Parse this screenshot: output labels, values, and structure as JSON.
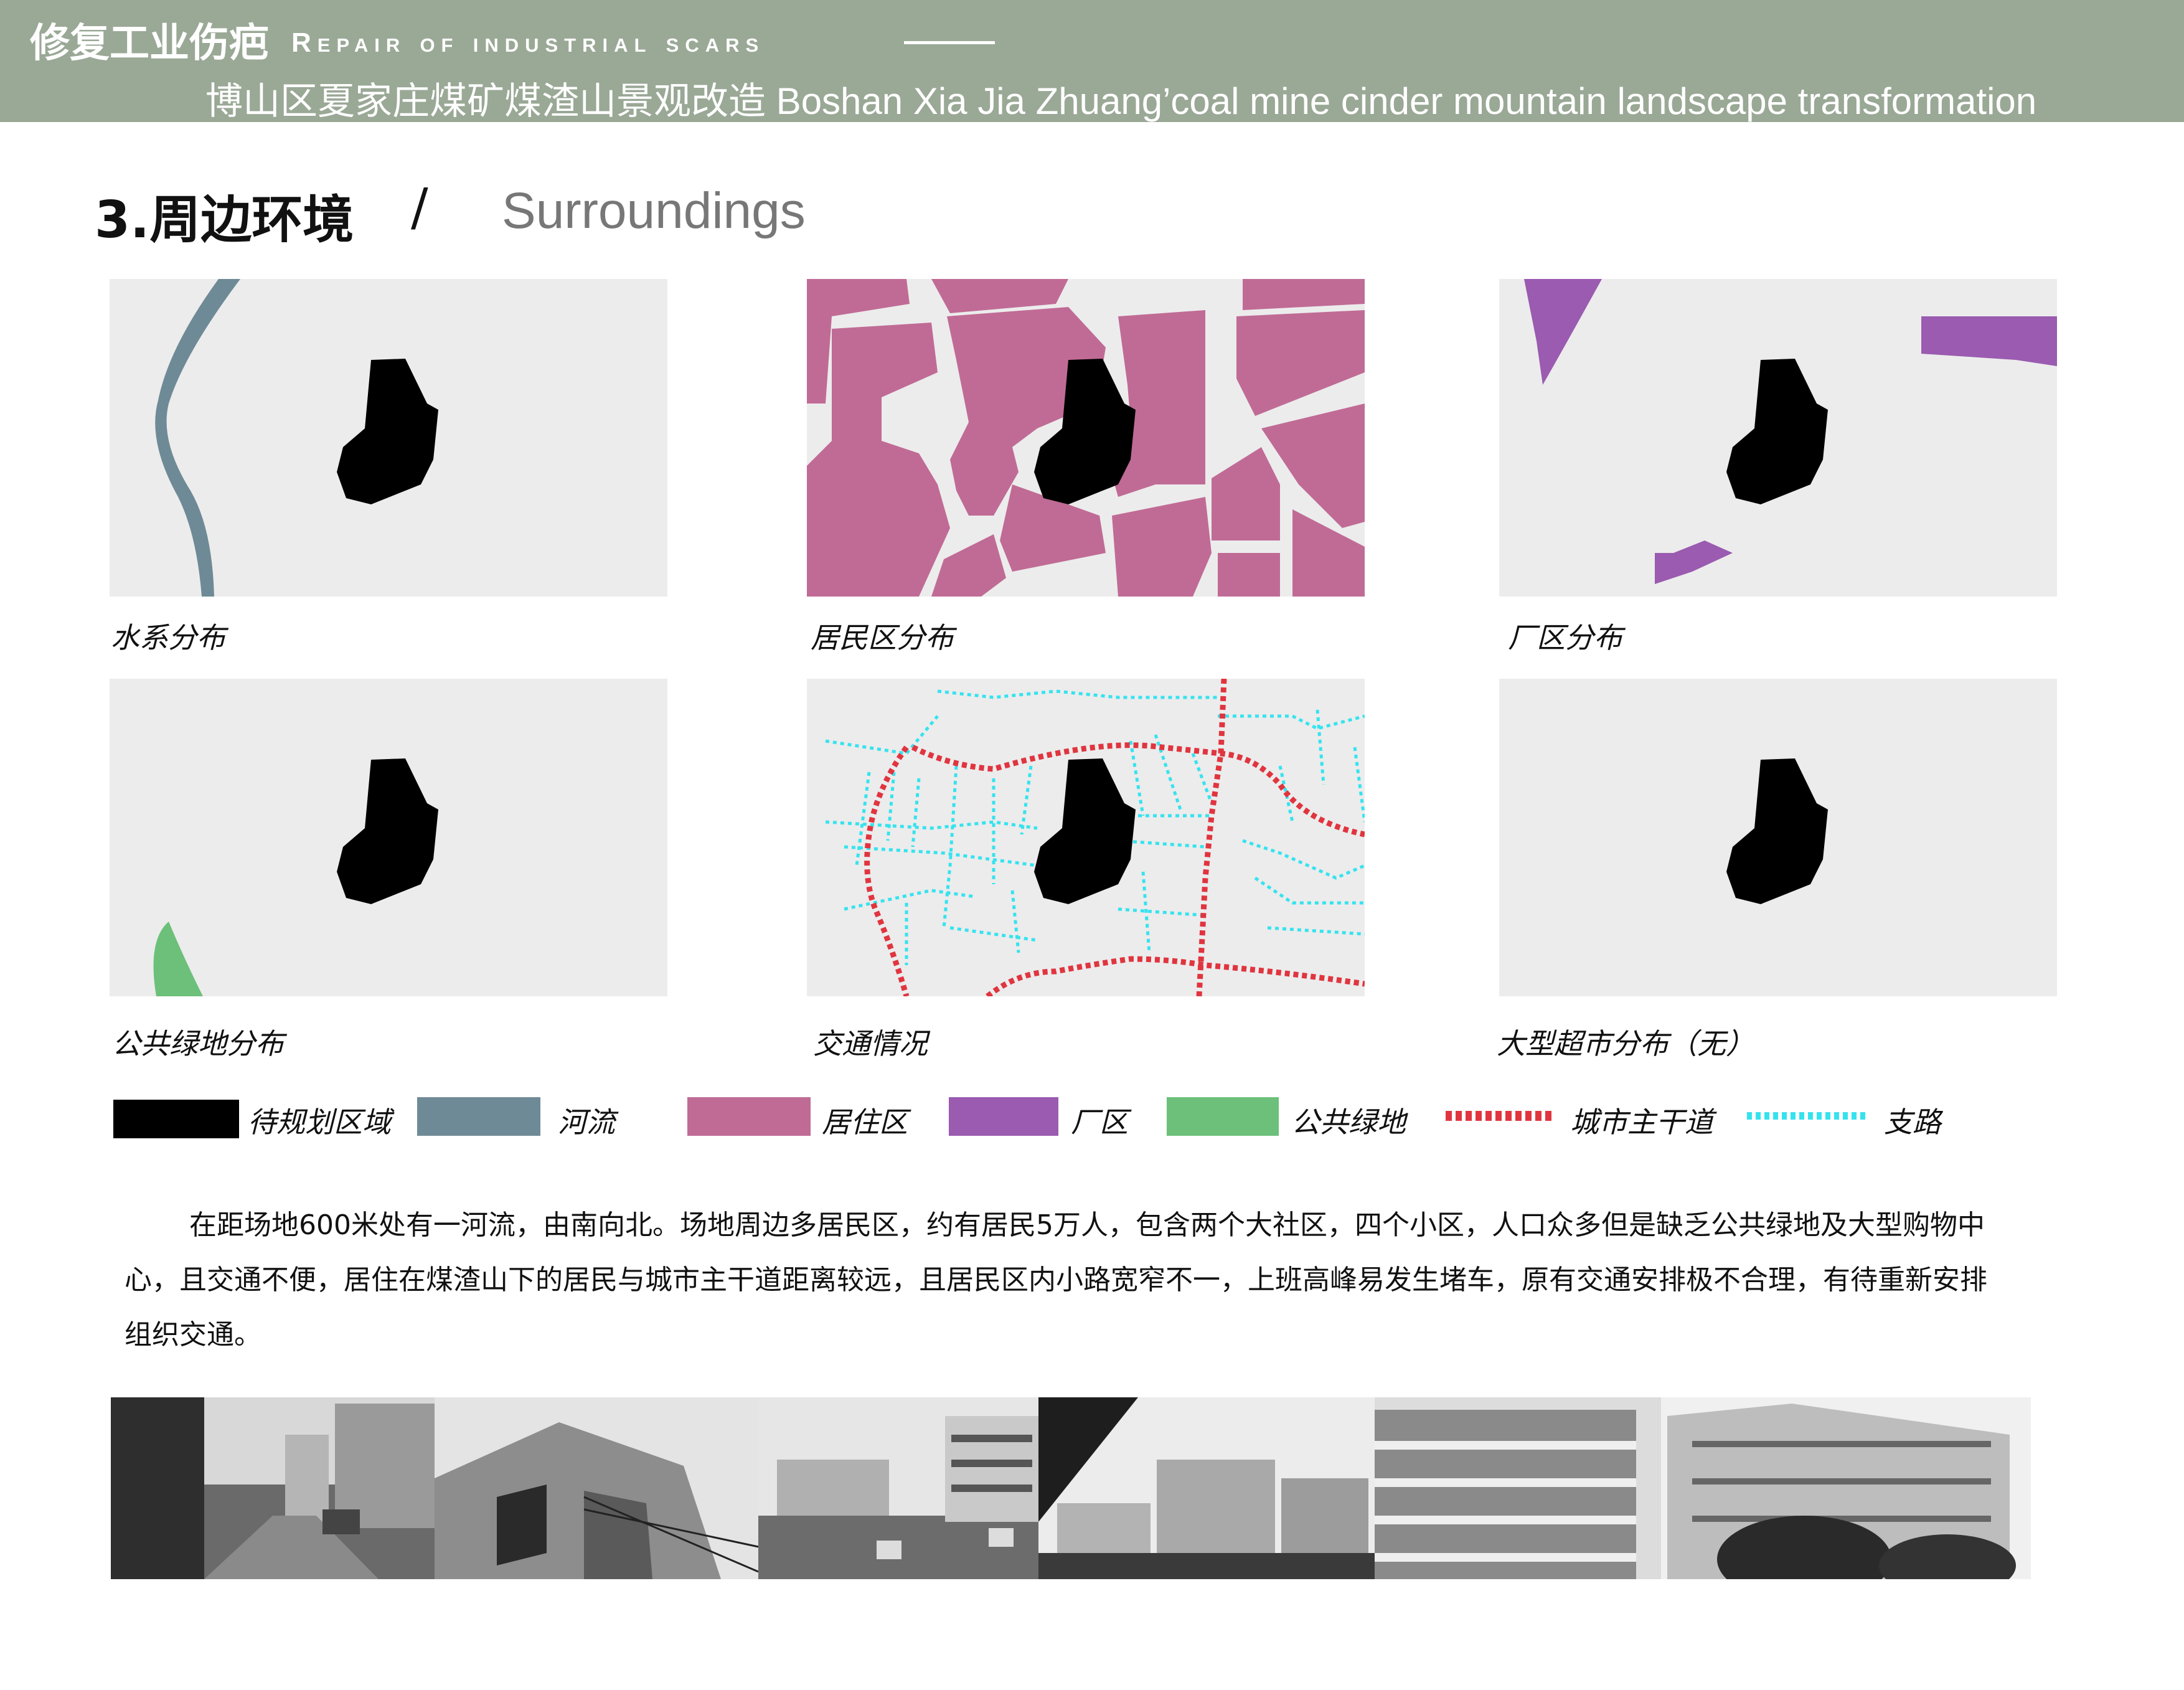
{
  "header": {
    "title_cn": "修复工业伤疤",
    "title_en": "Repair of industrial scars",
    "subtitle": "博山区夏家庄煤矿煤渣山景观改造  Boshan Xia Jia Zhuang’coal mine cinder mountain landscape transformation"
  },
  "section": {
    "title": "3.周边环境",
    "slash": "/",
    "title_en": "Surroundings"
  },
  "maps": [
    {
      "caption": "水系分布"
    },
    {
      "caption": "居民区分布"
    },
    {
      "caption": "厂区分布"
    },
    {
      "caption": "公共绿地分布"
    },
    {
      "caption": "交通情况"
    },
    {
      "caption": "大型超市分布（无）"
    }
  ],
  "legend": [
    {
      "label": "待规划区域",
      "color": "#000000",
      "style": "solid"
    },
    {
      "label": "河流",
      "color": "#6e8a96",
      "style": "solid"
    },
    {
      "label": "居住区",
      "color": "#c06b95",
      "style": "solid"
    },
    {
      "label": "厂区",
      "color": "#9a5bb0",
      "style": "solid"
    },
    {
      "label": "公共绿地",
      "color": "#6cc07a",
      "style": "solid"
    },
    {
      "label": "城市主干道",
      "color": "#e0353f",
      "style": "dashed"
    },
    {
      "label": "支路",
      "color": "#35e3ef",
      "style": "dotted"
    }
  ],
  "paragraph": [
    "在距场地600米处有一河流，由南向北。场地周边多居民区，约有居民5万人，包含两个大社区，四个小区，人口众多但是缺乏公共绿地及大型购物中心，且交通不便，居住在煤渣山下的居民与城市主干道距离较远，且居民区内小路宽窄不一，上班高峰易发生堵车，原有交通安排极不合理，有待重新安排组织交通。"
  ],
  "photos": [
    "alley-photo",
    "old-house-photo",
    "low-buildings-photo",
    "apartment-block-photo",
    "balcony-building-photo",
    "residential-building-photo"
  ]
}
